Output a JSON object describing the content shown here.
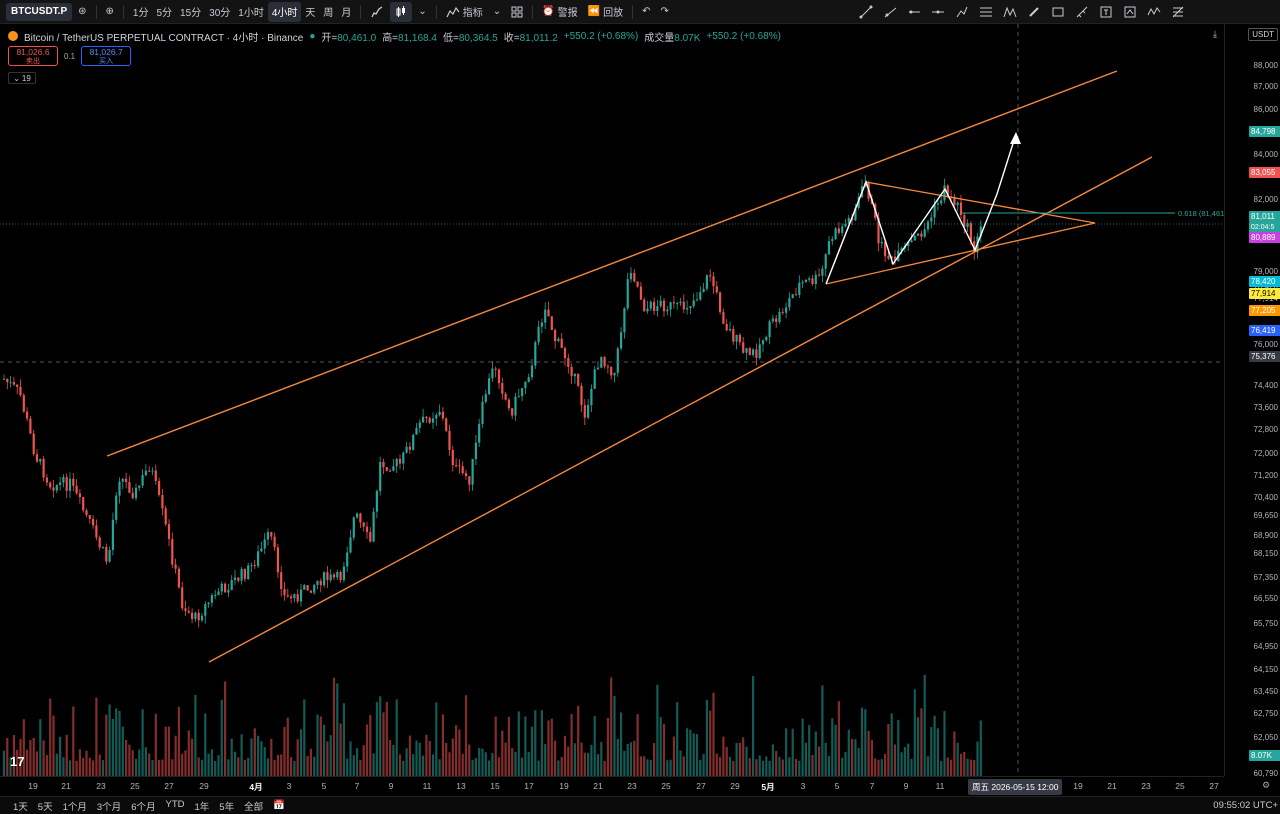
{
  "toolbar": {
    "symbol": "BTCUSDT.P",
    "intervals": [
      "1分",
      "5分",
      "15分",
      "30分",
      "1小时",
      "4小时",
      "天",
      "周",
      "月"
    ],
    "active_interval": "4小时",
    "indicators_label": "指标",
    "alert_label": "警报",
    "replay_label": "回放"
  },
  "header": {
    "title": "Bitcoin / TetherUS PERPETUAL CONTRACT · 4小时 · Binance",
    "open_label": "开=",
    "open": "80,461.0",
    "high_label": "高=",
    "high": "81,168.4",
    "low_label": "低=",
    "low": "80,364.5",
    "close_label": "收=",
    "close": "81,011.2",
    "change": "+550.2 (+0.68%)",
    "volume_label": "成交量",
    "volume": "8.07K",
    "volume_change": "+550.2 (+0.68%)"
  },
  "trade": {
    "sell_price": "81,026.6",
    "sell_label": "卖出",
    "spread": "0.1",
    "buy_price": "81,026.7",
    "buy_label": "买入",
    "indicator_count": "19"
  },
  "price_axis": {
    "currency": "USDT",
    "ticks": [
      "88,000",
      "87,000",
      "86,000",
      "84,000",
      "82,000",
      "79,000",
      "78,420",
      "77,914",
      "76,000",
      "74,400",
      "73,600",
      "72,800",
      "72,000",
      "71,200",
      "70,400",
      "69,650",
      "68,900",
      "68,150",
      "67,350",
      "66,550",
      "65,750",
      "64,950",
      "64,150",
      "63,450",
      "62,750",
      "62,050",
      "61,410",
      "60,790"
    ],
    "labels": [
      {
        "text": "84,798",
        "color": "#26a69a"
      },
      {
        "text": "83,055",
        "color": "#ef5350"
      },
      {
        "text": "81,011",
        "color": "#26a69a",
        "sub": "02:04:5"
      },
      {
        "text": "80,889",
        "color": "#c940e0"
      },
      {
        "text": "78,420",
        "color": "#00bcd4"
      },
      {
        "text": "77,914",
        "color": "#ffeb3b",
        "dark": true
      },
      {
        "text": "77,205",
        "color": "#ff9800"
      },
      {
        "text": "76,419",
        "color": "#2962ff"
      },
      {
        "text": "75,376",
        "color": "#363a45"
      },
      {
        "text": "8.07K",
        "color": "#26a69a"
      }
    ],
    "fib_label": "0.618 (81,461.8)"
  },
  "date_axis": {
    "ticks": [
      "19",
      "21",
      "23",
      "25",
      "27",
      "29",
      "4月",
      "3",
      "5",
      "7",
      "9",
      "11",
      "13",
      "15",
      "17",
      "19",
      "21",
      "23",
      "25",
      "27",
      "29",
      "5月",
      "3",
      "5",
      "7",
      "9",
      "11",
      "19",
      "21",
      "23",
      "25",
      "27"
    ],
    "crosshair": "周五 2026-05-15  12:00"
  },
  "bottombar": {
    "ranges": [
      "1天",
      "5天",
      "1个月",
      "3个月",
      "6个月",
      "YTD",
      "1年",
      "5年",
      "全部"
    ],
    "clock": "09:55:02 UTC+"
  },
  "colors": {
    "up": "#26a69a",
    "down": "#ef5350",
    "channel": "#f7893a",
    "pattern": "#ffffff"
  }
}
